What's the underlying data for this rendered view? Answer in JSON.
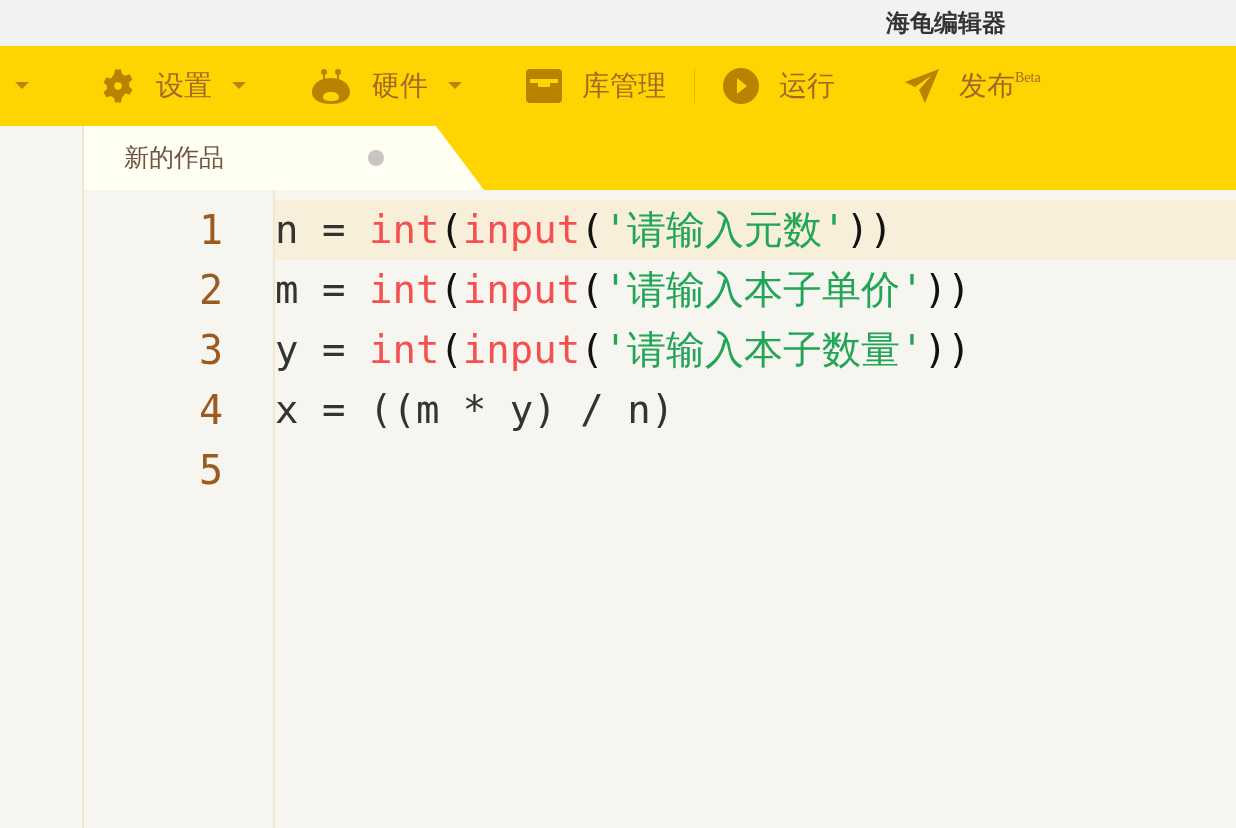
{
  "window": {
    "title": "海龟编辑器"
  },
  "toolbar": {
    "items": [
      {
        "label": "设置",
        "dropdown": true
      },
      {
        "label": "硬件",
        "dropdown": true
      },
      {
        "label": "库管理",
        "dropdown": false
      },
      {
        "label": "运行",
        "dropdown": false
      },
      {
        "label": "发布",
        "badge": "Beta",
        "dropdown": false
      }
    ]
  },
  "tabs": [
    {
      "label": "新的作品",
      "modified": true,
      "selected": true
    }
  ],
  "editor": {
    "lines": [
      {
        "number": "1",
        "active": true,
        "tokens": [
          {
            "kind": "plain",
            "text": "n = "
          },
          {
            "kind": "builtin",
            "text": "int"
          },
          {
            "kind": "paren",
            "text": "("
          },
          {
            "kind": "builtin",
            "text": "input"
          },
          {
            "kind": "paren",
            "text": "("
          },
          {
            "kind": "string",
            "text": "'请输入元数'"
          },
          {
            "kind": "paren",
            "text": "))"
          }
        ]
      },
      {
        "number": "2",
        "active": false,
        "tokens": [
          {
            "kind": "plain",
            "text": "m = "
          },
          {
            "kind": "builtin",
            "text": "int"
          },
          {
            "kind": "paren",
            "text": "("
          },
          {
            "kind": "builtin",
            "text": "input"
          },
          {
            "kind": "paren",
            "text": "("
          },
          {
            "kind": "string",
            "text": "'请输入本子单价'"
          },
          {
            "kind": "paren",
            "text": "))"
          }
        ]
      },
      {
        "number": "3",
        "active": false,
        "tokens": [
          {
            "kind": "plain",
            "text": "y = "
          },
          {
            "kind": "builtin",
            "text": "int"
          },
          {
            "kind": "paren",
            "text": "("
          },
          {
            "kind": "builtin",
            "text": "input"
          },
          {
            "kind": "paren",
            "text": "("
          },
          {
            "kind": "string",
            "text": "'请输入本子数量'"
          },
          {
            "kind": "paren",
            "text": "))"
          }
        ]
      },
      {
        "number": "4",
        "active": false,
        "tokens": [
          {
            "kind": "plain",
            "text": "x = ((m * y) / n)"
          }
        ]
      },
      {
        "number": "5",
        "active": false
      }
    ]
  }
}
